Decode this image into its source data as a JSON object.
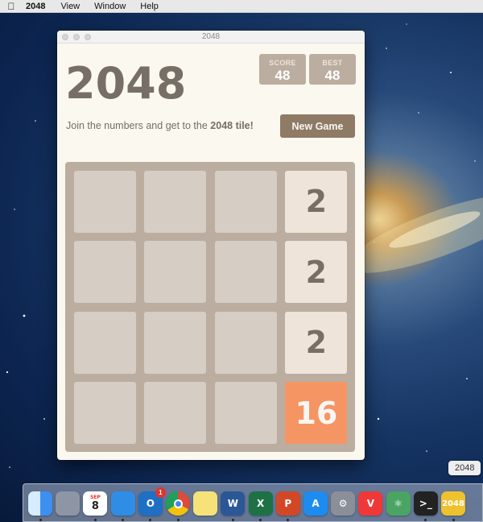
{
  "menubar": {
    "apple_icon": "apple-icon",
    "app_name": "2048",
    "items": [
      {
        "id": "view",
        "label": "View"
      },
      {
        "id": "window",
        "label": "Window"
      },
      {
        "id": "help",
        "label": "Help"
      }
    ]
  },
  "window": {
    "title": "2048"
  },
  "game": {
    "title": "2048",
    "score_label": "SCORE",
    "score_value": "48",
    "best_label": "BEST",
    "best_value": "48",
    "intro_prefix": "Join the numbers and get to the ",
    "intro_bold": "2048 tile!",
    "new_game_label": "New Game",
    "board": [
      [
        "",
        "",
        "",
        "2"
      ],
      [
        "",
        "",
        "",
        "2"
      ],
      [
        "",
        "",
        "",
        "2"
      ],
      [
        "",
        "",
        "",
        "16"
      ]
    ],
    "colors": {
      "background": "#faf8ef",
      "board": "#bbada0",
      "empty_cell": "#d6cdc4",
      "tile_2": "#eee4da",
      "tile_16": "#f59563",
      "text_dark": "#776e65",
      "button": "#8f7a66"
    }
  },
  "dock": {
    "tooltip": "2048",
    "items": [
      {
        "id": "finder",
        "icon": "finder-icon",
        "label": "",
        "color": "#3d8ff0",
        "running": true
      },
      {
        "id": "launchpad",
        "icon": "rocket-icon",
        "label": "",
        "color": "#8e95a4",
        "running": false
      },
      {
        "id": "calendar",
        "icon": "calendar-icon",
        "label": "8",
        "month": "SEP",
        "color": "#ffffff",
        "running": true
      },
      {
        "id": "safari",
        "icon": "compass-icon",
        "label": "",
        "color": "#2f8de6",
        "running": true
      },
      {
        "id": "outlook",
        "icon": "mail-icon",
        "label": "O",
        "badge": "1",
        "color": "#1f6fc5",
        "running": true
      },
      {
        "id": "chrome",
        "icon": "chrome-icon",
        "label": "",
        "color": "#dd4b39",
        "running": true
      },
      {
        "id": "notes",
        "icon": "notes-icon",
        "label": "",
        "color": "#f7e27a",
        "running": false
      },
      {
        "id": "word",
        "icon": "word-icon",
        "label": "W",
        "color": "#2b5797",
        "running": true
      },
      {
        "id": "excel",
        "icon": "excel-icon",
        "label": "X",
        "color": "#1e7145",
        "running": true
      },
      {
        "id": "powerpoint",
        "icon": "powerpoint-icon",
        "label": "P",
        "color": "#d24726",
        "running": true
      },
      {
        "id": "app-store",
        "icon": "app-store-icon",
        "label": "A",
        "color": "#1d8cf1",
        "running": false
      },
      {
        "id": "system-preferences",
        "icon": "gear-icon",
        "label": "⚙",
        "color": "#8a8f98",
        "running": false
      },
      {
        "id": "vivaldi",
        "icon": "vivaldi-icon",
        "label": "V",
        "color": "#ef3939",
        "running": false
      },
      {
        "id": "atom",
        "icon": "atom-icon",
        "label": "⚛",
        "color": "#4aa463",
        "running": false
      },
      {
        "id": "terminal",
        "icon": "terminal-icon",
        "label": ">_",
        "color": "#222222",
        "running": true
      },
      {
        "id": "2048",
        "icon": "2048-icon",
        "label": "2048",
        "color": "#edc22e",
        "running": true
      }
    ]
  }
}
